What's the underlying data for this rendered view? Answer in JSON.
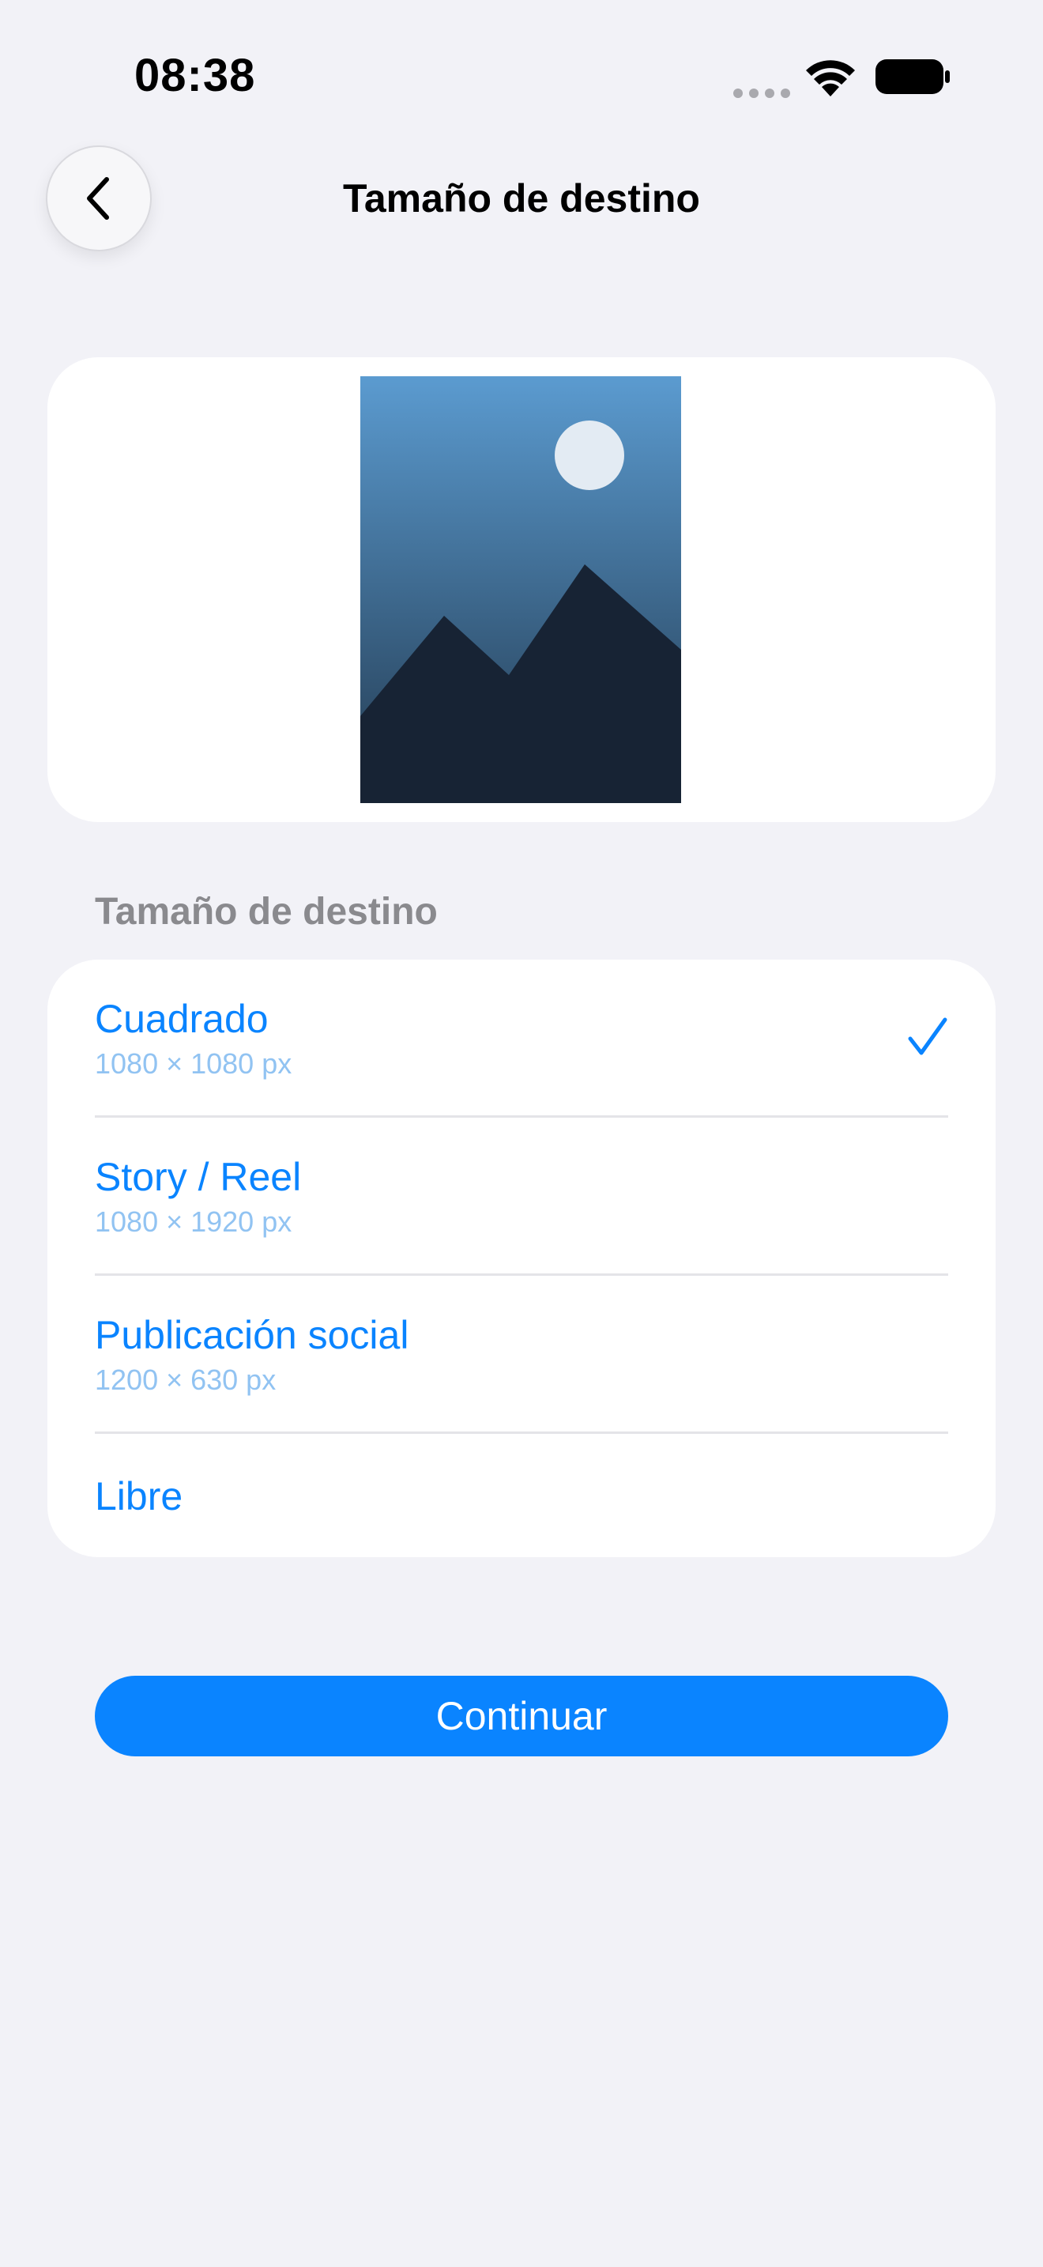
{
  "status_bar": {
    "time": "08:38",
    "signal_icon": "cellular-dots-icon",
    "wifi_icon": "wifi-icon",
    "battery_icon": "battery-icon"
  },
  "nav": {
    "back_icon": "chevron-left-icon",
    "title": "Tamaño de destino"
  },
  "preview": {
    "image_icon": "mountain-landscape-placeholder",
    "colors": {
      "sky_top": "#5b9bd0",
      "sky_bottom": "#22394f",
      "mountain": "#172334",
      "moon": "#e3ebf3"
    }
  },
  "section": {
    "header": "Tamaño de destino"
  },
  "options": [
    {
      "label": "Cuadrado",
      "subtitle": "1080 × 1080 px",
      "selected": true
    },
    {
      "label": "Story / Reel",
      "subtitle": "1080 × 1920 px",
      "selected": false
    },
    {
      "label": "Publicación social",
      "subtitle": "1200 × 630 px",
      "selected": false
    },
    {
      "label": "Libre",
      "subtitle": "",
      "selected": false
    }
  ],
  "continue_button": {
    "label": "Continuar"
  },
  "colors": {
    "accent": "#0a84ff",
    "background": "#f2f2f7",
    "card": "#ffffff",
    "secondary_text": "#8a8a8e"
  }
}
